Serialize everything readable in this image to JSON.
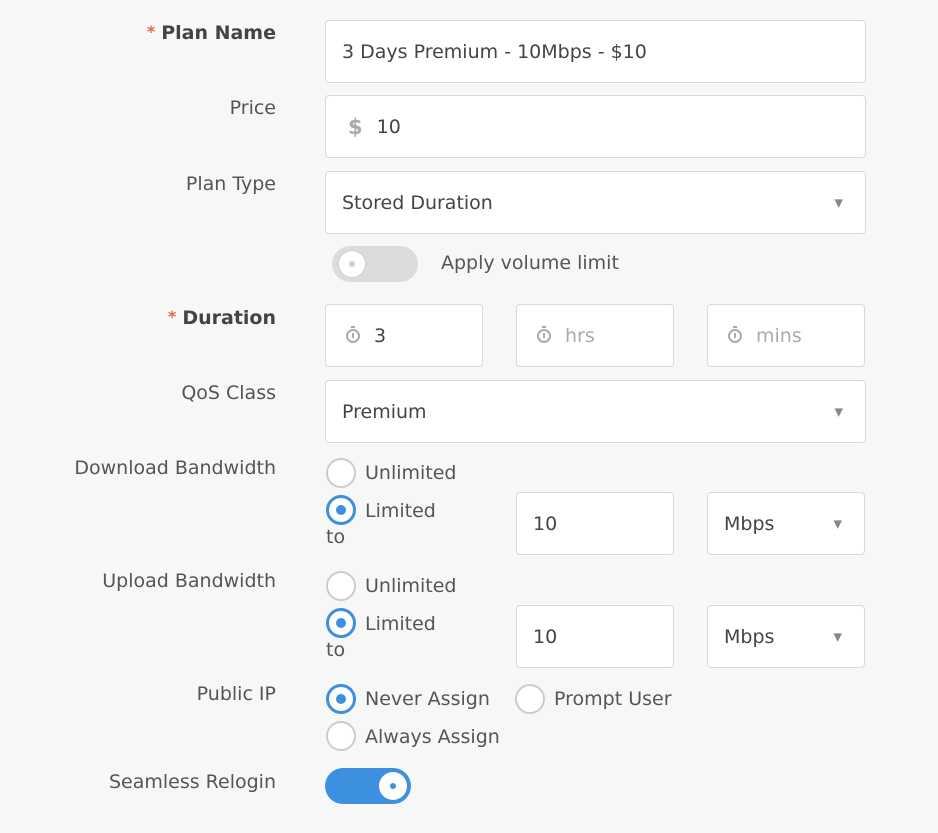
{
  "plan_name": {
    "label": "Plan Name",
    "required_mark": "*",
    "value": "3 Days Premium - 10Mbps - $10"
  },
  "price": {
    "label": "Price",
    "currency_symbol": "$",
    "value": "10"
  },
  "plan_type": {
    "label": "Plan Type",
    "value": "Stored Duration",
    "caret": "▼"
  },
  "volume_limit": {
    "label": "Apply volume limit",
    "enabled": false
  },
  "duration": {
    "label": "Duration",
    "required_mark": "*",
    "days_value": "3",
    "hrs_placeholder": "hrs",
    "mins_placeholder": "mins"
  },
  "qos_class": {
    "label": "QoS Class",
    "value": "Premium",
    "caret": "▼"
  },
  "download_bandwidth": {
    "label": "Download Bandwidth",
    "unlimited_label": "Unlimited",
    "limited_label": "Limited",
    "to_label": "to",
    "selected": "limited",
    "value": "10",
    "unit": "Mbps",
    "caret": "▼"
  },
  "upload_bandwidth": {
    "label": "Upload Bandwidth",
    "unlimited_label": "Unlimited",
    "limited_label": "Limited",
    "to_label": "to",
    "selected": "limited",
    "value": "10",
    "unit": "Mbps",
    "caret": "▼"
  },
  "public_ip": {
    "label": "Public IP",
    "options": [
      "Never Assign",
      "Prompt User",
      "Always Assign"
    ],
    "selected": "Never Assign"
  },
  "seamless_relogin": {
    "label": "Seamless Relogin",
    "enabled": true
  },
  "colors": {
    "accent": "#3d8fe0",
    "required": "#e06a4f",
    "background": "#f7f7f7"
  }
}
